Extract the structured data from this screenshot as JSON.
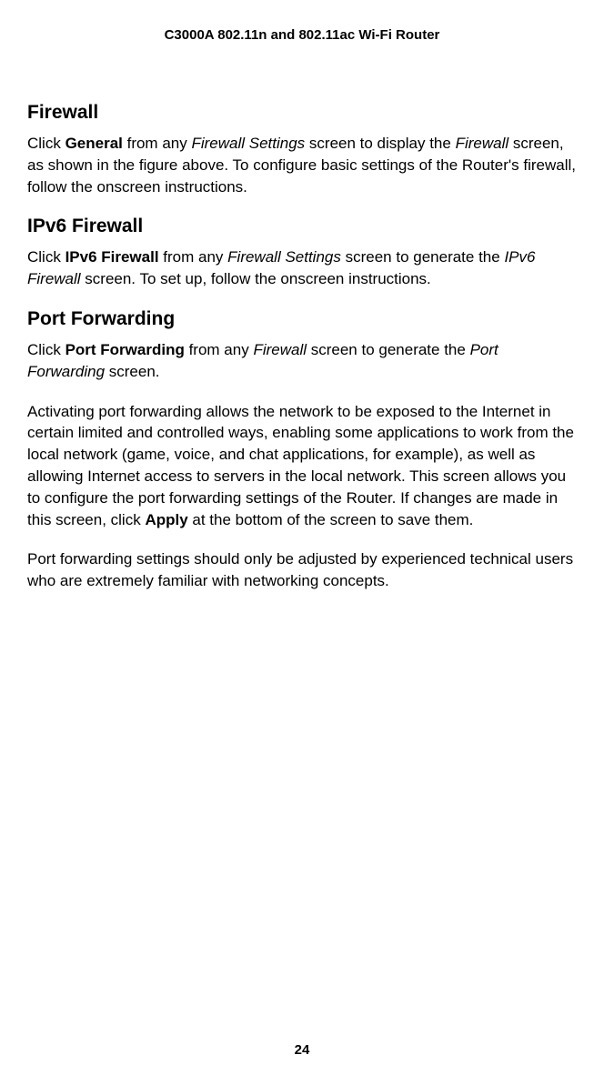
{
  "header": {
    "title": "C3000A 802.11n and 802.11ac Wi-Fi Router"
  },
  "sections": {
    "firewall": {
      "heading": "Firewall",
      "p1_a": "Click ",
      "p1_b": "General",
      "p1_c": " from any ",
      "p1_d": "Firewall Settings",
      "p1_e": " screen to display the ",
      "p1_f": "Firewall",
      "p1_g": " screen, as shown in the figure above. To configure basic settings of the Router's firewall, follow the onscreen instructions."
    },
    "ipv6": {
      "heading": "IPv6 Firewall",
      "p1_a": "Click ",
      "p1_b": "IPv6 Firewall",
      "p1_c": " from any ",
      "p1_d": "Firewall Settings",
      "p1_e": " screen to generate the ",
      "p1_f": "IPv6 Firewall",
      "p1_g": " screen. To set up, follow the onscreen instructions."
    },
    "port": {
      "heading": "Port Forwarding",
      "p1_a": "Click ",
      "p1_b": "Port Forwarding",
      "p1_c": " from any ",
      "p1_d": "Firewall",
      "p1_e": " screen to generate the ",
      "p1_f": "Port Forwarding",
      "p1_g": " screen.",
      "p2_a": "Activating port forwarding allows the network to be exposed to the Internet in certain limited and controlled ways, enabling some applications to work from the local network (game, voice, and chat applications, for example), as well as allowing Internet access to servers in the local network. This screen allows you to configure the port forwarding settings of the Router. If changes are made in this screen, click ",
      "p2_b": "Apply",
      "p2_c": " at the bottom of the screen to save them.",
      "p3": "Port forwarding settings should only be adjusted by experienced technical users who are extremely familiar with networking concepts."
    }
  },
  "footer": {
    "page_number": "24"
  }
}
